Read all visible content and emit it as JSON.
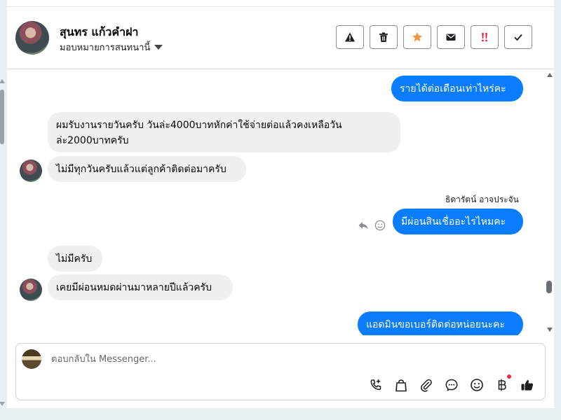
{
  "header": {
    "contact_name": "สุนทร แก้วคำฝา",
    "assign_label": "มอบหมายการสนทนานี้",
    "actions": [
      {
        "name": "spam-button",
        "icon": "warning-icon"
      },
      {
        "name": "delete-button",
        "icon": "trash-icon"
      },
      {
        "name": "star-button",
        "icon": "star-icon"
      },
      {
        "name": "mark-unread-button",
        "icon": "envelope-icon"
      },
      {
        "name": "follow-up-button",
        "icon": "exclamation-icon"
      },
      {
        "name": "mark-done-button",
        "icon": "check-icon"
      }
    ]
  },
  "messages": [
    {
      "direction": "out",
      "text": "รายได้ต่อเดือนเท่าไหร่คะ"
    },
    {
      "direction": "in",
      "text": "ผมรับงานรายวันครับ วันล่ะ4000บาทหักค่าใช้จ่ายต่อแล้วคงเหลือวันล่ะ2000บาทครับ"
    },
    {
      "direction": "in",
      "text": "ไม่มีทุกวันครับแล้วแต่ลูกค้าติดต่อมาครับ"
    },
    {
      "direction": "out",
      "text": "มีผ่อนสินเชื่ออะไรไหมคะ",
      "sender": "ธิดารัตน์ อาจประจัน"
    },
    {
      "direction": "in",
      "text": "ไม่มีครับ"
    },
    {
      "direction": "in",
      "text": "เคยมีผ่อนหมดผ่านมาหลายปีแล้วครับ"
    },
    {
      "direction": "out",
      "text": "แอดมินขอเบอร์ติดต่อหน่อยนะคะ"
    }
  ],
  "composer": {
    "placeholder": "ตอบกลับใน Messenger...",
    "tools": [
      "call-add-icon",
      "shopping-bag-icon",
      "paperclip-icon",
      "chat-bubble-icon",
      "smiley-icon",
      "baht-icon",
      "thumbs-up-icon"
    ]
  },
  "colors": {
    "outgoing_bubble": "#0a7cff",
    "incoming_bubble": "#f0f0f0",
    "star": "#f5923e",
    "alert": "#e41e3f",
    "notification_dot": "#f02849"
  }
}
